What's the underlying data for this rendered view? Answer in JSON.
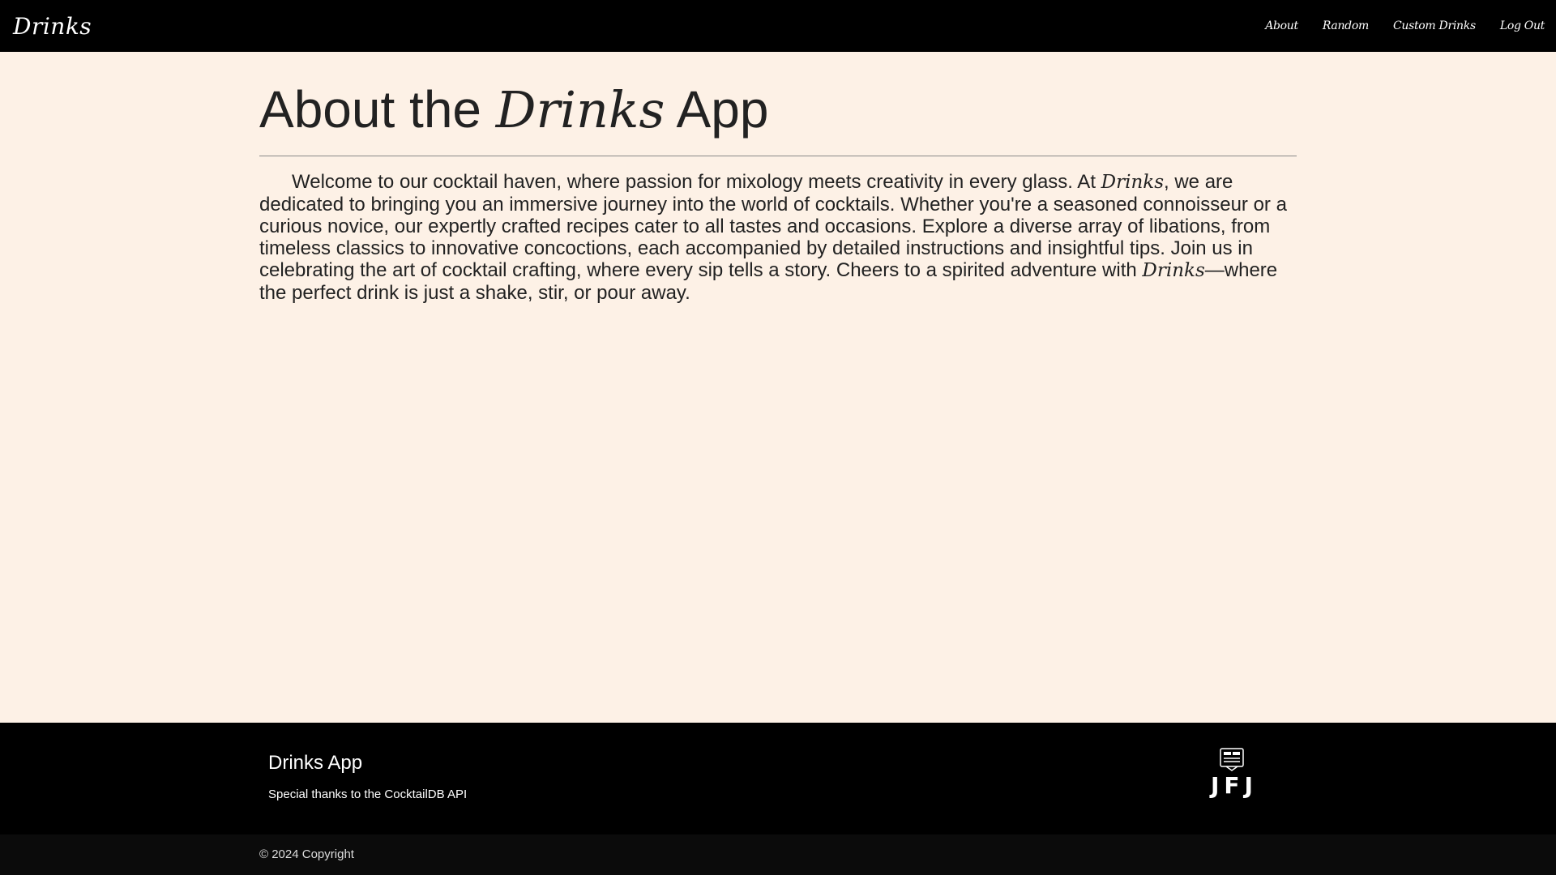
{
  "navbar": {
    "brand": "Drinks",
    "links": [
      "About",
      "Random",
      "Custom Drinks",
      "Log Out"
    ]
  },
  "main": {
    "title_prefix": "About the",
    "title_brand": "Drinks",
    "title_suffix": "App",
    "paragraph": {
      "part1": "Welcome to our cocktail haven, where passion for mixology meets creativity in every glass. At ",
      "brand1": "Drinks",
      "part2": ", we are dedicated to bringing you an immersive journey into the world of cocktails. Whether you're a seasoned connoisseur or a curious novice, our expertly crafted recipes cater to all tastes and occasions. Explore a diverse array of libations, from timeless classics to innovative concoctions, each accompanied by detailed instructions and insightful tips. Join us in celebrating the art of cocktail crafting, where every sip tells a story. Cheers to a spirited adventure with ",
      "brand2": "Drinks",
      "part3": "—where the perfect drink is just a shake, stir, or pour away."
    }
  },
  "footer": {
    "title": "Drinks App",
    "thanks": "Special thanks to the CocktailDB API",
    "logo_text": "JFJ",
    "logo_icon": "cocktail-shaker-icon",
    "copyright": "© 2024 Copyright"
  },
  "colors": {
    "background": "#fdf1e6",
    "navbar": "#000000",
    "footer": "#000000",
    "text": "#222222"
  }
}
